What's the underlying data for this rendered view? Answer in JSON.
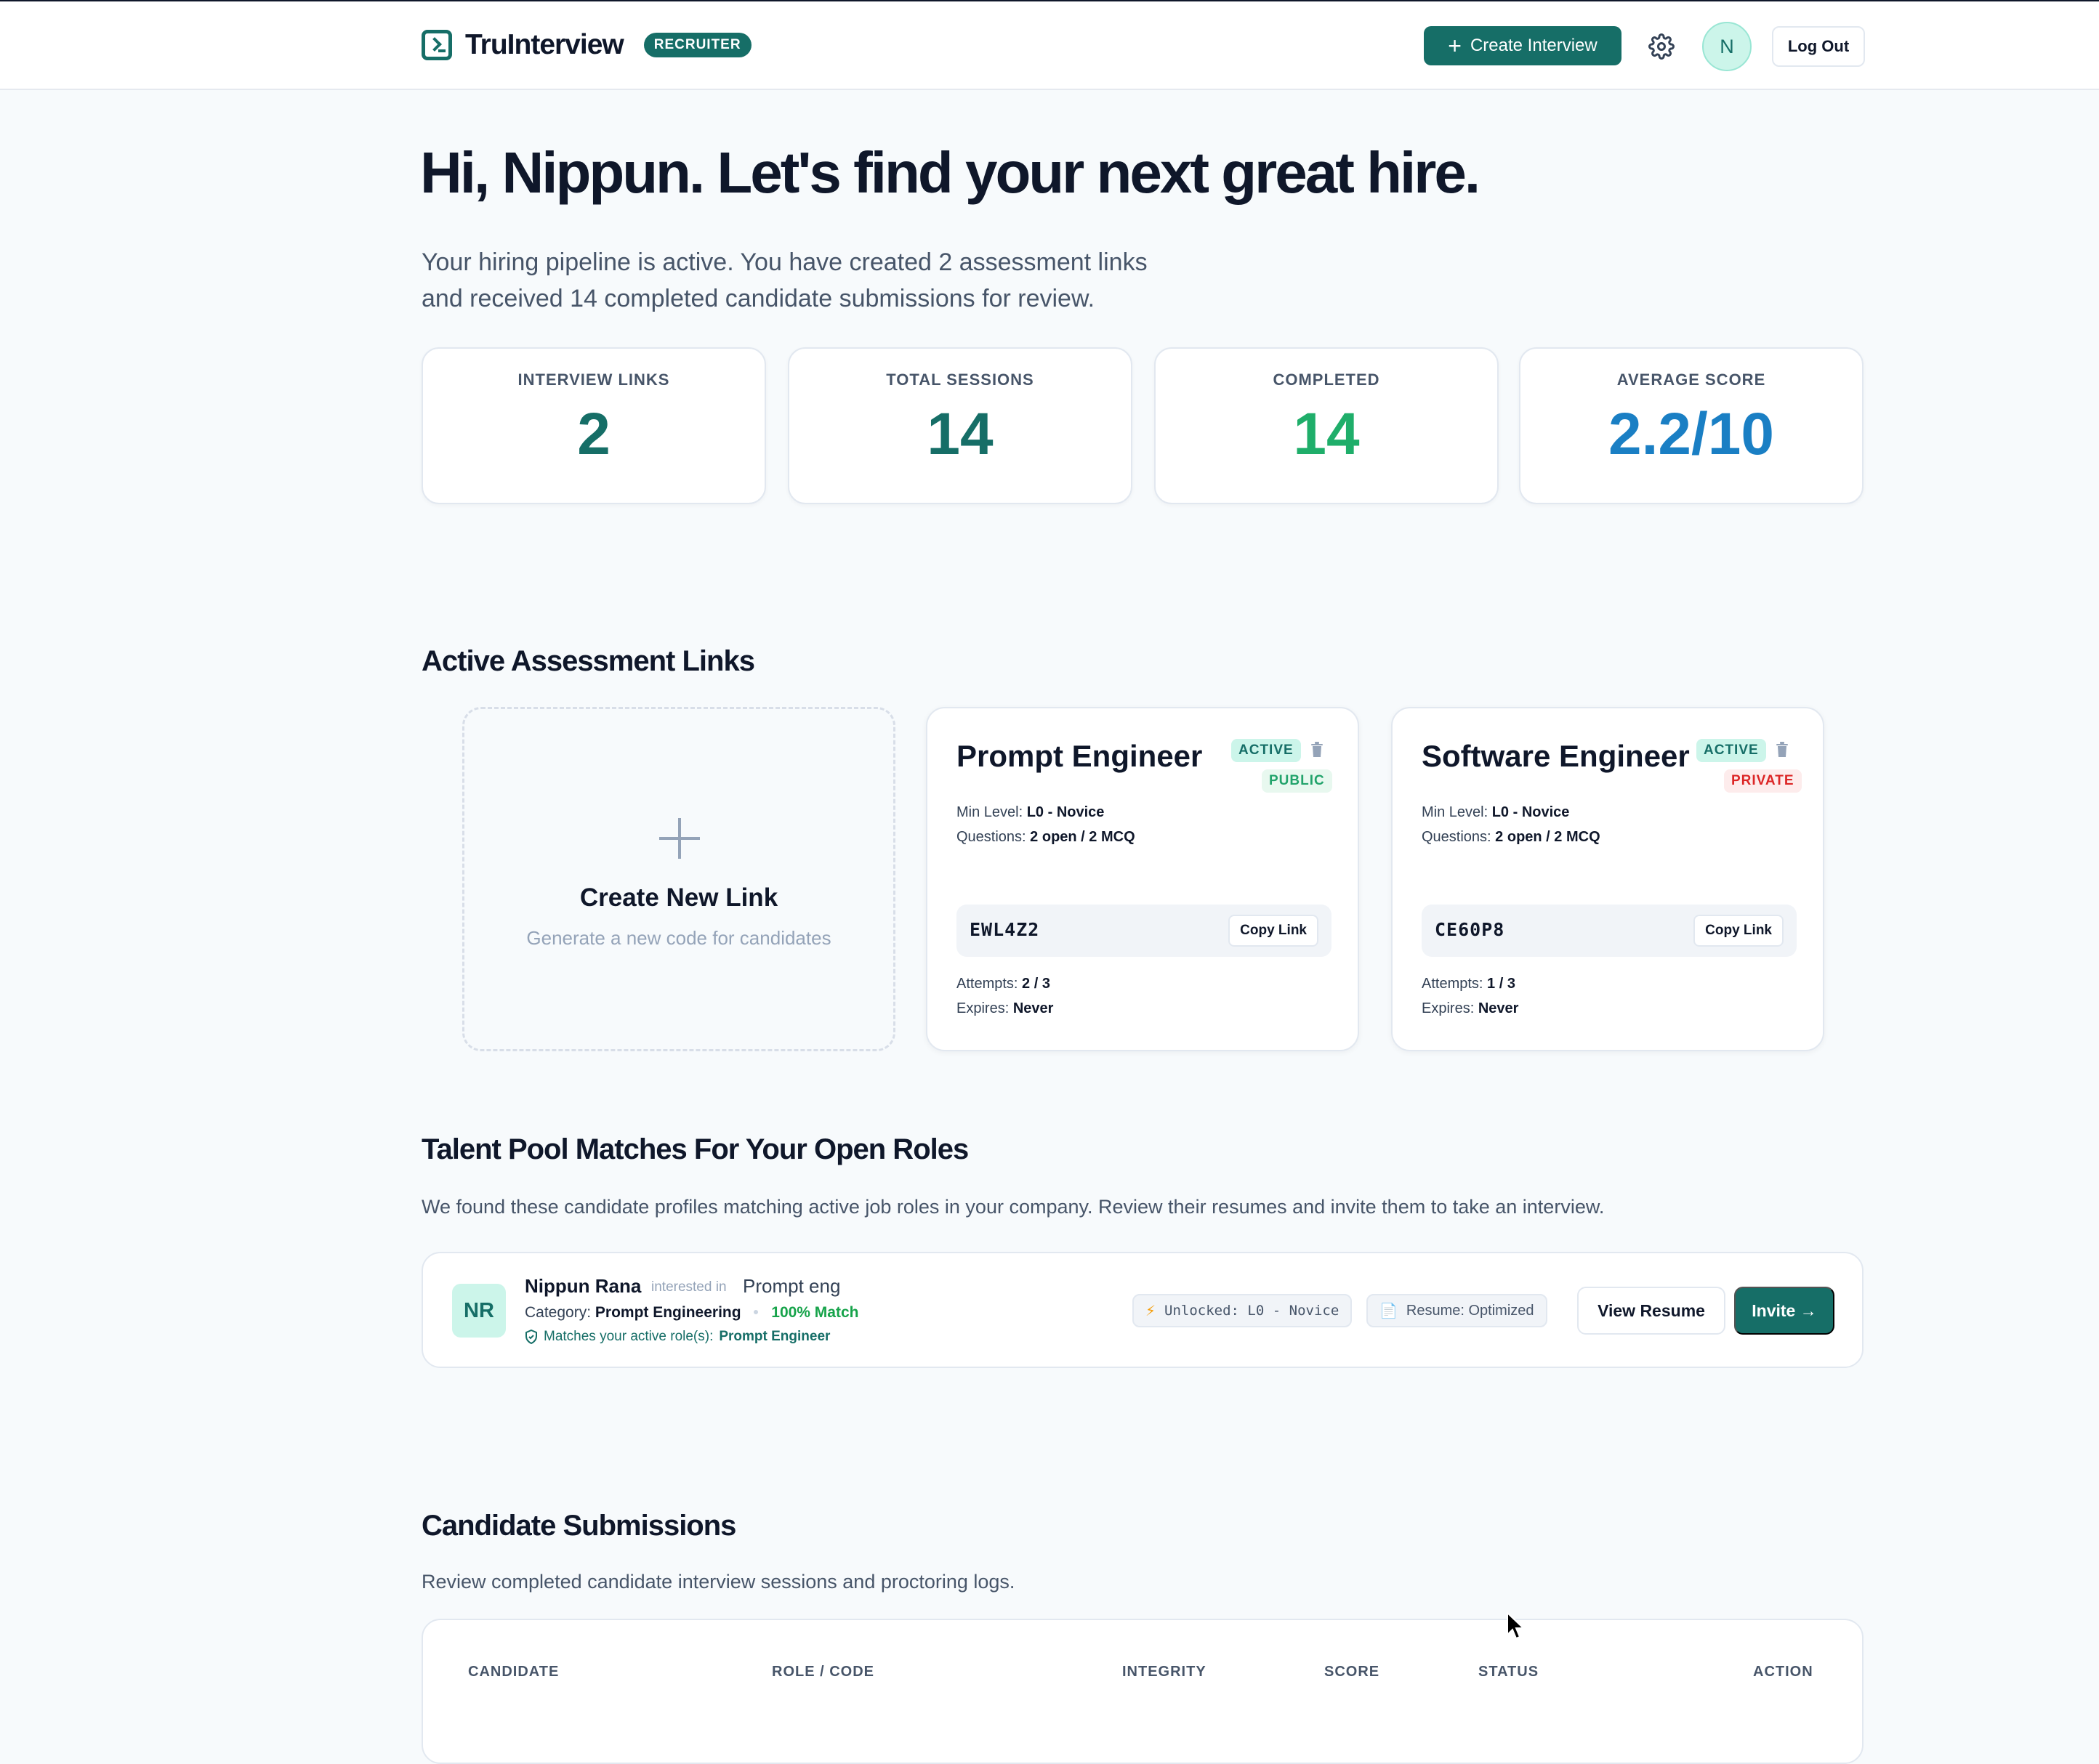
{
  "header": {
    "app_name": "TruInterview",
    "role_badge": "RECRUITER",
    "create_label": "Create Interview",
    "avatar_initial": "N",
    "logout_label": "Log Out"
  },
  "hero": {
    "greeting": "Hi, Nippun. Let's find your next great hire.",
    "line1": "Your hiring pipeline is active. You have created 2 assessment links",
    "line2": "and received 14 completed candidate submissions for review."
  },
  "stats": [
    {
      "label": "INTERVIEW LINKS",
      "value": "2",
      "color": "#166e67"
    },
    {
      "label": "TOTAL SESSIONS",
      "value": "14",
      "color": "#166e67"
    },
    {
      "label": "COMPLETED",
      "value": "14",
      "color": "#1fae6a"
    },
    {
      "label": "AVERAGE SCORE",
      "value": "2.2/10",
      "color": "#1a7fc4"
    }
  ],
  "assessment": {
    "title": "Active Assessment Links",
    "new_link_title": "Create New Link",
    "new_link_sub": "Generate a new code for candidates",
    "links": [
      {
        "title": "Prompt Engineer",
        "status": "ACTIVE",
        "visibility": "PUBLIC",
        "min_level_label": "Min Level:",
        "min_level": "L0 - Novice",
        "questions_label": "Questions:",
        "questions": "2 open / 2 MCQ",
        "code": "EWL4Z2",
        "copy_label": "Copy Link",
        "attempts_label": "Attempts:",
        "attempts": "2 / 3",
        "expires_label": "Expires:",
        "expires": "Never"
      },
      {
        "title": "Software Engineer",
        "status": "ACTIVE",
        "visibility": "PRIVATE",
        "min_level_label": "Min Level:",
        "min_level": "L0 - Novice",
        "questions_label": "Questions:",
        "questions": "2 open / 2 MCQ",
        "code": "CE60P8",
        "copy_label": "Copy Link",
        "attempts_label": "Attempts:",
        "attempts": "1 / 3",
        "expires_label": "Expires:",
        "expires": "Never"
      }
    ]
  },
  "talent": {
    "title": "Talent Pool Matches For Your Open Roles",
    "description": "We found these candidate profiles matching active job roles in your company. Review their resumes and invite them to take an interview.",
    "candidate": {
      "initials": "NR",
      "name": "Nippun Rana",
      "interested_label": "interested in",
      "interested_role": "Prompt eng",
      "category_label": "Category:",
      "category": "Prompt Engineering",
      "match": "100% Match",
      "matches_label": "Matches your active role(s):",
      "matches_role": "Prompt Engineer",
      "unlocked": "Unlocked: L0 - Novice",
      "resume": "Resume: Optimized",
      "view_resume": "View Resume",
      "invite": "Invite →"
    }
  },
  "submissions": {
    "title": "Candidate Submissions",
    "description": "Review completed candidate interview sessions and proctoring logs.",
    "columns": [
      "CANDIDATE",
      "ROLE / CODE",
      "INTEGRITY",
      "SCORE",
      "STATUS",
      "ACTION"
    ]
  }
}
